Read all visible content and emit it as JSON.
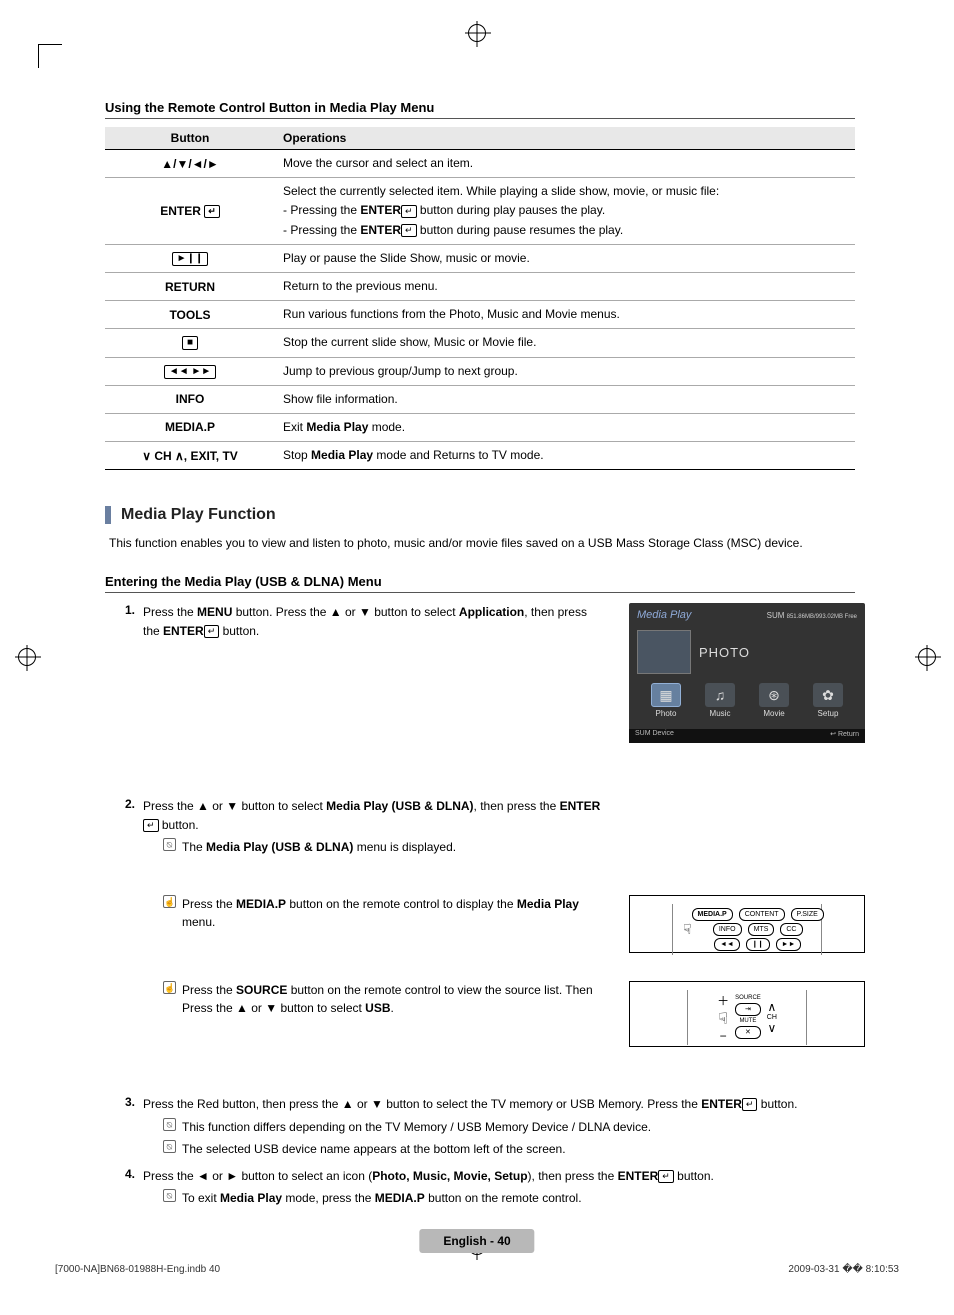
{
  "header": "Using the Remote Control Button in Media Play Menu",
  "table": {
    "hButton": "Button",
    "hOps": "Operations",
    "rows": [
      {
        "btn": "▲/▼/◄/►",
        "ops": [
          "Move the cursor and select an item."
        ]
      },
      {
        "btn": "ENTER",
        "enterIcon": true,
        "ops": [
          "Select the currently selected item. While playing a slide show, movie, or music file:",
          {
            "pre": "- Pressing the ",
            "bold": "ENTER",
            "icon": true,
            "post": " button during play pauses the play."
          },
          {
            "pre": "- Pressing the ",
            "bold": "ENTER",
            "icon": true,
            "post": " button during pause resumes the play."
          }
        ]
      },
      {
        "btnSym": "►❙❙",
        "ops": [
          "Play or pause the Slide Show, music or movie."
        ]
      },
      {
        "btn": "RETURN",
        "ops": [
          "Return to the previous menu."
        ]
      },
      {
        "btn": "TOOLS",
        "ops": [
          "Run various functions from the Photo, Music and Movie menus."
        ]
      },
      {
        "btnSym": "■",
        "ops": [
          "Stop the current slide show, Music or Movie file."
        ]
      },
      {
        "btnSym": "◄◄ ►►",
        "ops": [
          "Jump to previous group/Jump to next group."
        ]
      },
      {
        "btn": "INFO",
        "ops": [
          "Show file information."
        ]
      },
      {
        "btn": "MEDIA.P",
        "ops": [
          {
            "pre": "Exit ",
            "bold": "Media Play",
            "post": " mode."
          }
        ]
      },
      {
        "btn": "∨ CH ∧, EXIT, TV",
        "ops": [
          {
            "pre": "Stop ",
            "bold": "Media Play",
            "post": " mode and Returns to TV mode."
          }
        ]
      }
    ]
  },
  "sectionTitle": "Media Play Function",
  "intro": "This function enables you to view and listen to photo, music and/or movie files saved on a USB Mass Storage Class (MSC) device.",
  "subhead": "Entering the Media Play (USB & DLNA) Menu",
  "steps": {
    "s1": {
      "n": "1.",
      "t1": "Press the ",
      "b1": "MENU",
      "t2": " button. Press the ▲ or ▼ button to select ",
      "b2": "Application",
      "t3": ", then press the ",
      "b3": "ENTER",
      "t4": " button."
    },
    "s2": {
      "n": "2.",
      "t1": "Press the ▲ or ▼ button to select ",
      "b1": "Media Play (USB & DLNA)",
      "t2": ", then press the ",
      "b2": "ENTER",
      "t3": " button.",
      "note": {
        "t1": "The ",
        "b": "Media Play (USB & DLNA)",
        "t2": " menu is displayed."
      },
      "tip1": {
        "t1": "Press the ",
        "b1": "MEDIA.P",
        "t2": " button on the remote control to display the ",
        "b2": "Media Play",
        "t3": " menu."
      },
      "tip2": {
        "t1": "Press the ",
        "b1": "SOURCE",
        "t2": " button on the remote control to view the source list. Then Press the ▲ or ▼ button to select ",
        "b2": "USB",
        "t3": "."
      }
    },
    "s3": {
      "n": "3.",
      "t1": "Press the Red button, then press the ▲ or ▼ button to select the TV memory or USB Memory. Press the ",
      "b1": "ENTER",
      "t2": " button.",
      "notes": [
        "This function differs depending on the TV Memory / USB Memory Device / DLNA device.",
        "The selected USB device name appears at the bottom left of the screen."
      ]
    },
    "s4": {
      "n": "4.",
      "t1": "Press the ◄ or ► button to select an icon (",
      "b1": "Photo, Music, Movie, Setup",
      "t2": "), then press the ",
      "b2": "ENTER",
      "t3": " button.",
      "note": {
        "t1": "To exit ",
        "b": "Media Play",
        "t2": " mode, press the ",
        "b2": "MEDIA.P",
        "t3": " button on the remote control."
      }
    }
  },
  "tv": {
    "title": "Media Play",
    "sum": "SUM",
    "sub": "851.86MB/993.02MB Free",
    "big": "PHOTO",
    "icons": {
      "photo": "Photo",
      "music": "Music",
      "movie": "Movie",
      "setup": "Setup"
    },
    "footerL": "SUM    Device",
    "footerR": "Return"
  },
  "remote1": {
    "row1": [
      "MEDIA.P",
      "CONTENT",
      "P.SIZE"
    ],
    "row2": [
      "INFO",
      "MTS",
      "CC"
    ],
    "row3": [
      "◄◄",
      "❙❙",
      "►►"
    ]
  },
  "remote2": {
    "source": "SOURCE",
    "mute": "MUTE",
    "ch": "CH"
  },
  "footerPage": "English - 40",
  "footerL": "[7000-NA]BN68-01988H-Eng.indb   40",
  "footerR": "2009-03-31   �� 8:10:53"
}
